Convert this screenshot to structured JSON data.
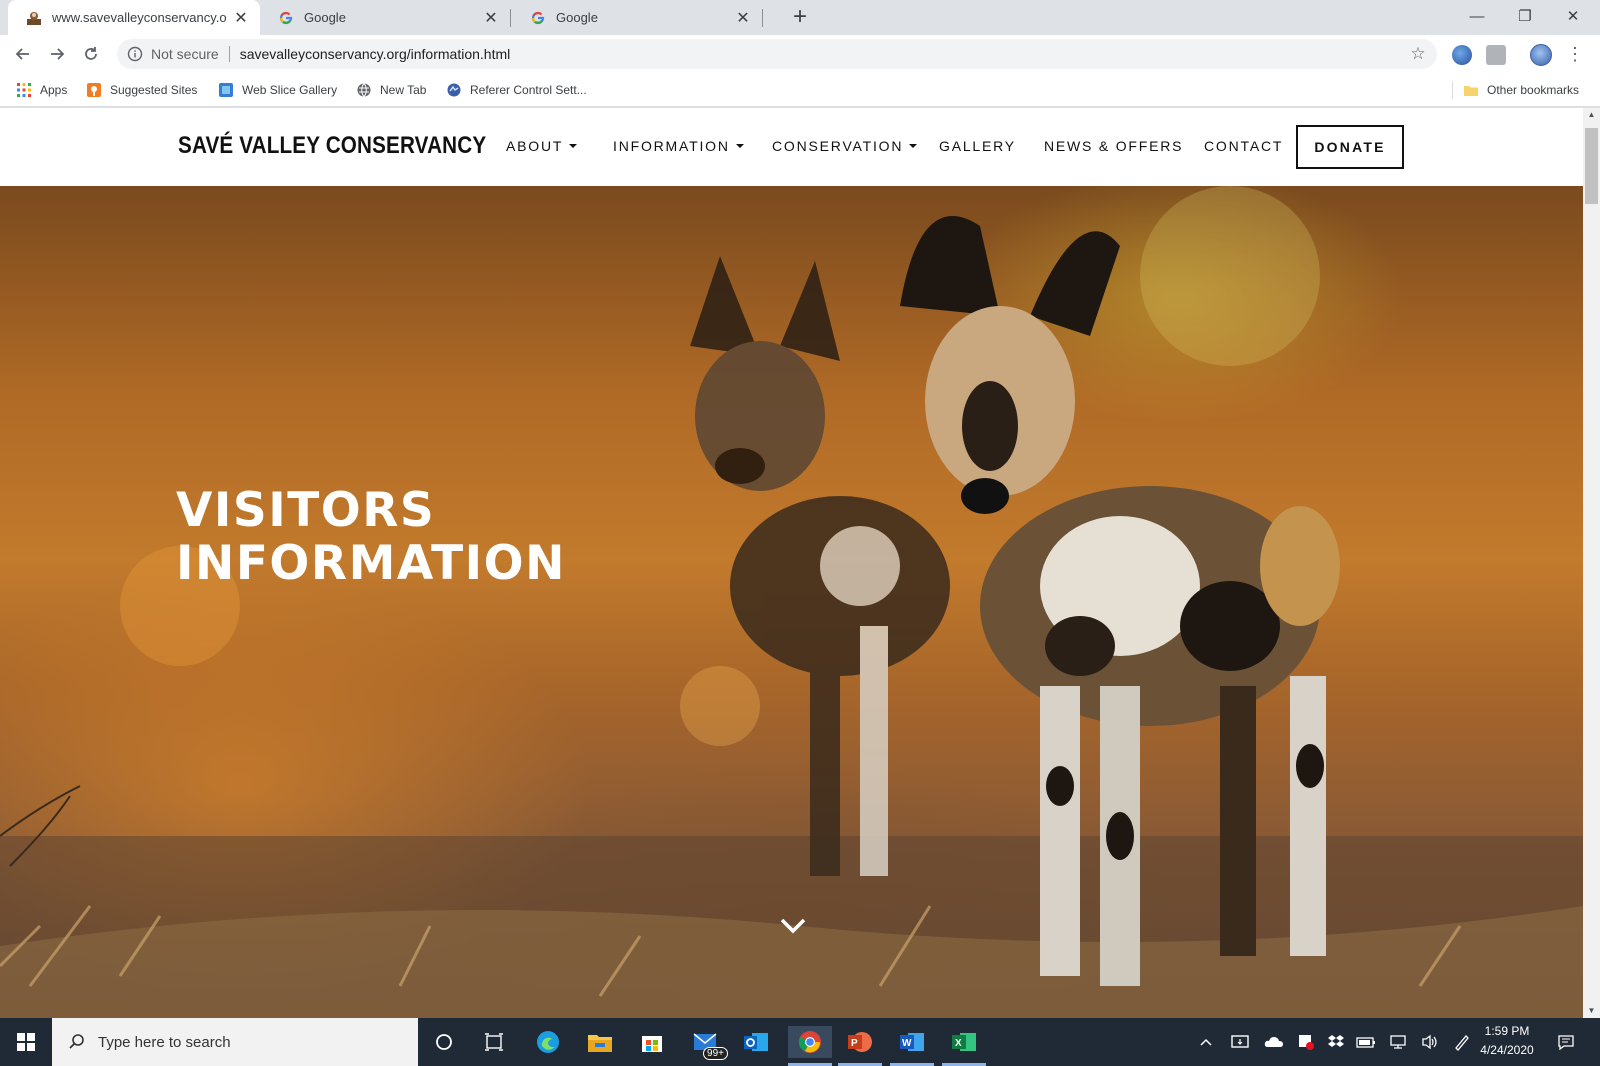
{
  "browser": {
    "tabs": [
      {
        "title": "www.savevalleyconservancy.org/i",
        "active": true
      },
      {
        "title": "Google",
        "active": false
      },
      {
        "title": "Google",
        "active": false
      }
    ],
    "new_tab": "+",
    "window_controls": {
      "minimize": "—",
      "restore": "❐",
      "close": "✕"
    },
    "address": {
      "security_label": "Not secure",
      "url": "savevalleyconservancy.org/information.html"
    },
    "bookmarks": [
      {
        "label": "Apps",
        "icon": "apps-grid-icon"
      },
      {
        "label": "Suggested Sites",
        "icon": "suggested-sites-icon"
      },
      {
        "label": "Web Slice Gallery",
        "icon": "web-slice-icon"
      },
      {
        "label": "New Tab",
        "icon": "globe-icon"
      },
      {
        "label": "Referer Control Sett...",
        "icon": "referer-control-icon"
      }
    ],
    "other_bookmarks": "Other bookmarks"
  },
  "site": {
    "logo": "SAVÉ VALLEY CONSERVANCY",
    "nav": [
      {
        "label": "ABOUT",
        "dropdown": true
      },
      {
        "label": "INFORMATION",
        "dropdown": true
      },
      {
        "label": "CONSERVATION",
        "dropdown": true
      },
      {
        "label": "GALLERY",
        "dropdown": false
      },
      {
        "label": "NEWS & OFFERS",
        "dropdown": false
      },
      {
        "label": "CONTACT",
        "dropdown": false
      }
    ],
    "donate": "DONATE",
    "hero": {
      "title_line1": "VISITORS",
      "title_line2": "INFORMATION"
    }
  },
  "taskbar": {
    "search_placeholder": "Type here to search",
    "mail_badge": "99+",
    "time": "1:59 PM",
    "date": "4/24/2020"
  },
  "colors": {
    "chrome_frame": "#dee1e6",
    "taskbar": "#1f2a36",
    "hero_base": "#b06a26"
  }
}
